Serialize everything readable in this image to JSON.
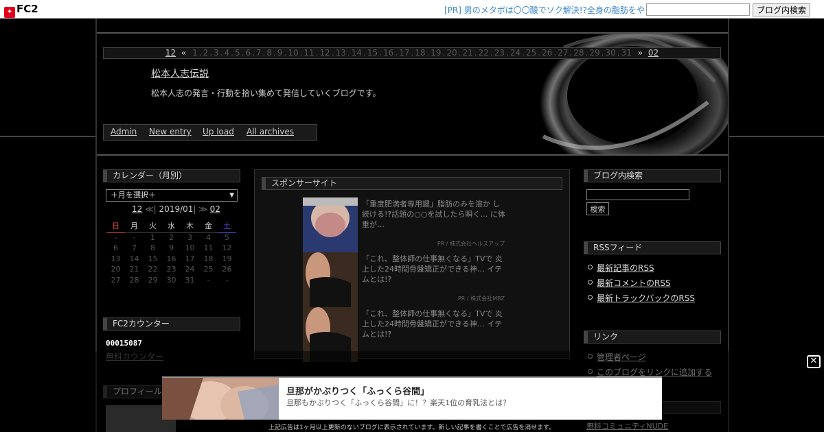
{
  "fc2bar": {
    "logo": "FC2",
    "pr_text": "[PR] 男のメタボは〇〇酸でソク解決!?全身の脂肪をや",
    "search_button": "ブログ内検索"
  },
  "header": {
    "prev_month": "12",
    "prev_arrow": "«",
    "days": [
      "1",
      "2",
      "3",
      "4",
      "5",
      "6",
      "7",
      "8",
      "9",
      "10",
      "11",
      "12",
      "13",
      "14",
      "15",
      "16",
      "17",
      "18",
      "19",
      "20",
      "21",
      "22",
      "23",
      "24",
      "25",
      "26",
      "27",
      "28",
      "29",
      "30",
      "31"
    ],
    "next_arrow": "»",
    "next_month": "02",
    "blog_title": "松本人志伝説",
    "blog_desc": "松本人志の発言・行動を拾い集めて発信していくブログです。",
    "menu": [
      "Admin",
      "New entry",
      "Up load",
      "All archives"
    ]
  },
  "calendar": {
    "heading": "カレンダー（月別）",
    "select": "＋月を選択＋",
    "nav_prev": "12",
    "nav_prev_arrow": "≪",
    "nav_current": "2019/01",
    "nav_next_arrow": "≫",
    "nav_next": "02",
    "weekdays": [
      "日",
      "月",
      "火",
      "水",
      "木",
      "金",
      "土"
    ],
    "weeks": [
      [
        "-",
        "-",
        "1",
        "2",
        "3",
        "4",
        "5"
      ],
      [
        "6",
        "7",
        "8",
        "9",
        "10",
        "11",
        "12"
      ],
      [
        "13",
        "14",
        "15",
        "16",
        "17",
        "18",
        "19"
      ],
      [
        "20",
        "21",
        "22",
        "23",
        "24",
        "25",
        "26"
      ],
      [
        "27",
        "28",
        "29",
        "30",
        "31",
        "-",
        "-"
      ]
    ]
  },
  "counter": {
    "heading": "FC2カウンター",
    "value": "00015087",
    "link": "無料カウンター"
  },
  "profile": {
    "heading": "プロフィール"
  },
  "sponsor": {
    "heading": "スポンサーサイト",
    "ads": [
      {
        "text": "「重度肥満者専用鍵」脂肪のみを溶か し続ける!?話題の○○を試したら瞬く… に体重が…",
        "source": "PR / 株式会社ヘルスアップ"
      },
      {
        "text": "「これ、整体師の仕事無くなる」TVで 炎上した24時間骨盤矯正ができる神… イテムとは!?",
        "source": "PR / 株式会社MBZ"
      },
      {
        "text": "「これ、整体師の仕事無くなる」TVで 炎上した24時間骨盤矯正ができる神… イテムとは!?",
        "source": ""
      }
    ]
  },
  "right": {
    "search_heading": "ブログ内検索",
    "search_button": "検索",
    "rss_heading": "RSSフィード",
    "rss_items": [
      "最新記事のRSS",
      "最新コメントのRSS",
      "最新トラックバックのRSS"
    ],
    "links_heading": "リンク",
    "links_items": [
      "管理者ページ",
      "このブログをリンクに追加する"
    ],
    "footer_link": "無料コミュニティNUDE"
  },
  "overlay": {
    "title": "旦那がかぶりつく「ふっくら谷間」",
    "subtitle": "旦那もかぶりつく「ふっくら谷間」に！？楽天1位の育乳法とは？",
    "note": "上記広告は1ヶ月以上更新のないブログに表示されています。新しい記事を書くことで広告を消せます。",
    "close": "✕"
  }
}
